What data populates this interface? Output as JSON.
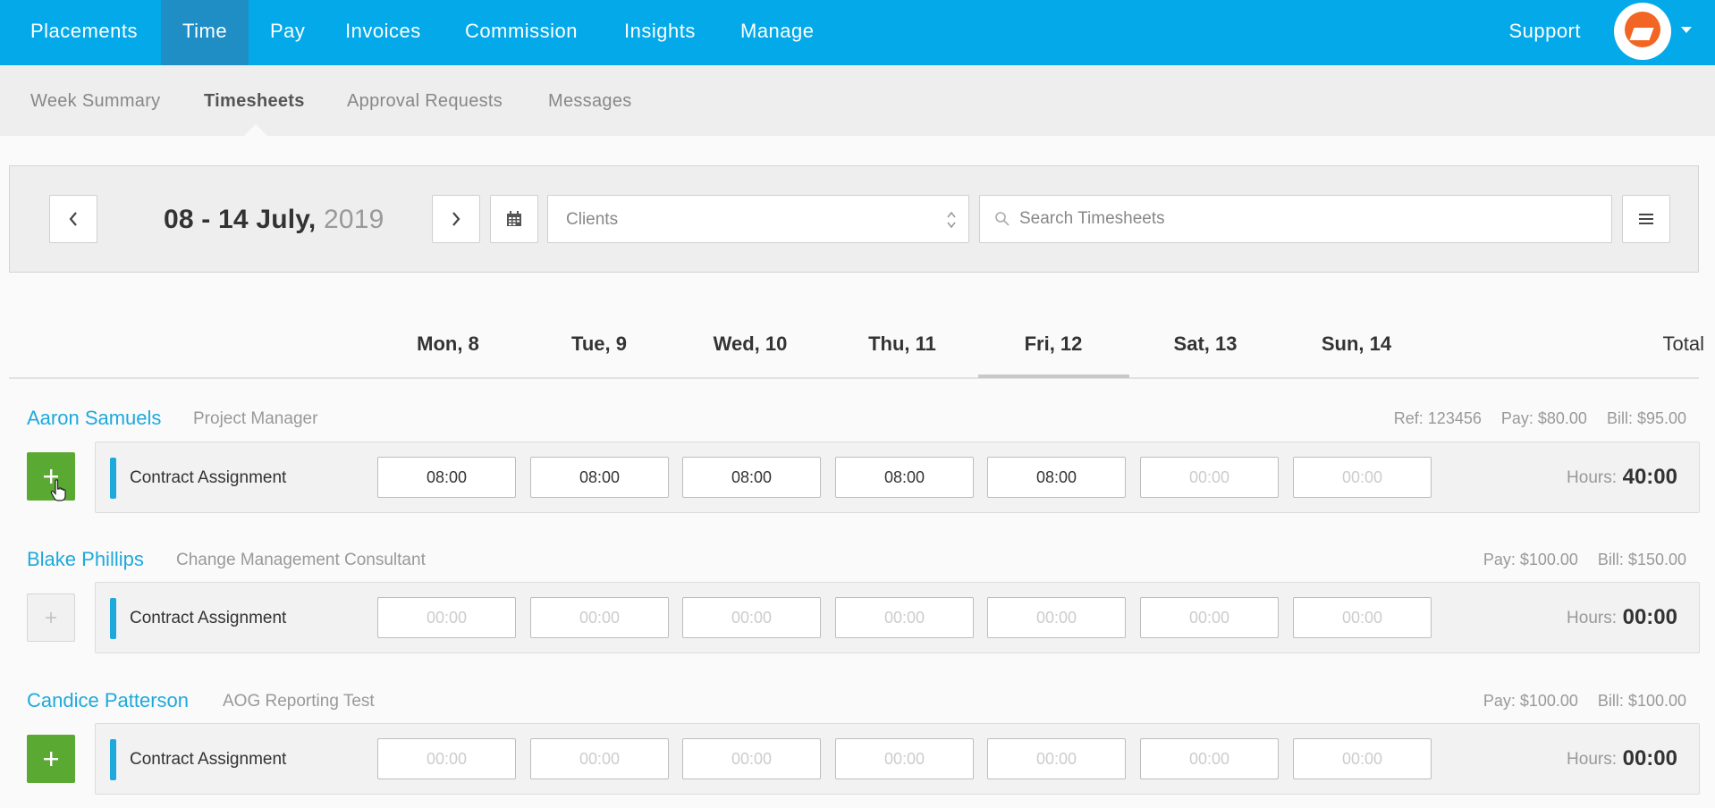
{
  "topnav": {
    "items": [
      {
        "label": "Placements",
        "active": false
      },
      {
        "label": "Time",
        "active": true
      },
      {
        "label": "Pay",
        "active": false
      },
      {
        "label": "Invoices",
        "active": false
      },
      {
        "label": "Commission",
        "active": false
      },
      {
        "label": "Insights",
        "active": false
      },
      {
        "label": "Manage",
        "active": false
      }
    ],
    "support_label": "Support",
    "avatar_icon": "user-avatar-icon",
    "accent_color": "#03a9e9",
    "active_color": "#1e8ec5"
  },
  "subnav": {
    "items": [
      {
        "label": "Week Summary",
        "active": false
      },
      {
        "label": "Timesheets",
        "active": true
      },
      {
        "label": "Approval Requests",
        "active": false
      },
      {
        "label": "Messages",
        "active": false
      }
    ]
  },
  "toolbar": {
    "prev_icon": "chevron-left-icon",
    "next_icon": "chevron-right-icon",
    "date_range": "08 - 14 July,",
    "year": "2019",
    "calendar_icon": "calendar-icon",
    "clients_placeholder": "Clients",
    "search_placeholder": "Search Timesheets",
    "menu_icon": "hamburger-menu-icon"
  },
  "grid": {
    "days": [
      "Mon, 8",
      "Tue, 9",
      "Wed, 10",
      "Thu, 11",
      "Fri, 12",
      "Sat, 13",
      "Sun, 14"
    ],
    "active_day": "Fri, 12",
    "total_label": "Total"
  },
  "people": [
    {
      "name": "Aaron Samuels",
      "role": "Project Manager",
      "ref": "Ref: 123456",
      "pay": "Pay: $80.00",
      "bill": "Bill: $95.00",
      "add_enabled": true,
      "assignment": "Contract Assignment",
      "times": [
        "08:00",
        "08:00",
        "08:00",
        "08:00",
        "08:00",
        "",
        ""
      ],
      "placeholder": "00:00",
      "hours_label": "Hours:",
      "hours_total": "40:00"
    },
    {
      "name": "Blake Phillips",
      "role": "Change Management Consultant",
      "ref": "",
      "pay": "Pay: $100.00",
      "bill": "Bill: $150.00",
      "add_enabled": false,
      "assignment": "Contract Assignment",
      "times": [
        "",
        "",
        "",
        "",
        "",
        "",
        ""
      ],
      "placeholder": "00:00",
      "hours_label": "Hours:",
      "hours_total": "00:00"
    },
    {
      "name": "Candice Patterson",
      "role": "AOG Reporting Test",
      "ref": "",
      "pay": "Pay: $100.00",
      "bill": "Bill: $100.00",
      "add_enabled": true,
      "assignment": "Contract Assignment",
      "times": [
        "",
        "",
        "",
        "",
        "",
        "",
        ""
      ],
      "placeholder": "00:00",
      "hours_label": "Hours:",
      "hours_total": "00:00"
    }
  ],
  "colors": {
    "link": "#1ea9dc",
    "add_button": "#5aa932"
  }
}
